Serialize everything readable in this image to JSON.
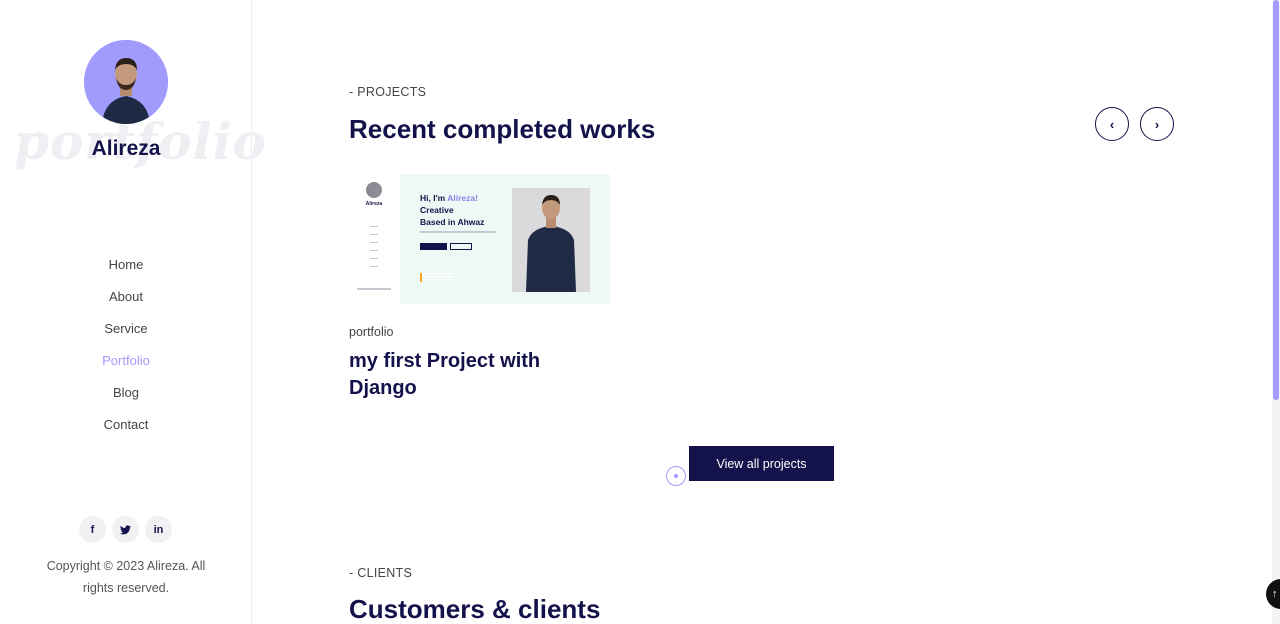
{
  "sidebar": {
    "watermark": "portfolio",
    "name": "Alireza",
    "nav": [
      {
        "label": "Home",
        "active": false
      },
      {
        "label": "About",
        "active": false
      },
      {
        "label": "Service",
        "active": false
      },
      {
        "label": "Portfolio",
        "active": true
      },
      {
        "label": "Blog",
        "active": false
      },
      {
        "label": "Contact",
        "active": false
      }
    ],
    "socials": [
      {
        "icon": "facebook-icon",
        "glyph": "f"
      },
      {
        "icon": "twitter-icon",
        "glyph": "❧"
      },
      {
        "icon": "linkedin-icon",
        "glyph": "in"
      }
    ],
    "copyright": "Copyright © 2023 Alireza. All rights reserved."
  },
  "projects": {
    "eyebrow": "- PROJECTS",
    "title": "Recent completed works",
    "prev_glyph": "‹",
    "next_glyph": "›",
    "items": [
      {
        "category": "portfolio",
        "title": "my first Project with Django",
        "thumb": {
          "sidebar_name": "Alireza",
          "hi_prefix": "Hi, I'm",
          "hi_name": "Alireza!",
          "line2": "Creative",
          "line3": "Based in Ahwaz"
        }
      }
    ],
    "view_all_label": "View all projects"
  },
  "clients": {
    "eyebrow": "- CLIENTS",
    "title": "Customers & clients"
  },
  "colors": {
    "accent": "#a29bfe",
    "navy": "#14124a"
  }
}
